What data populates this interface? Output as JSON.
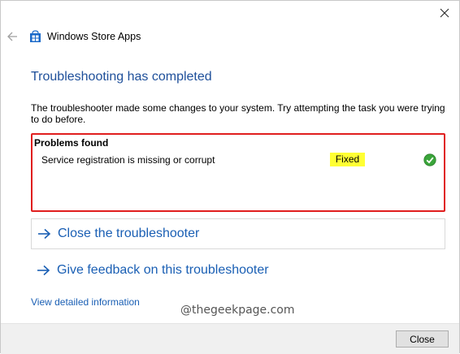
{
  "window": {
    "title": "Windows Store Apps"
  },
  "main": {
    "heading": "Troubleshooting has completed",
    "description": "The troubleshooter made some changes to your system. Try attempting the task you were trying to do before."
  },
  "problems": {
    "title": "Problems found",
    "items": [
      {
        "name": "Service registration is missing or corrupt",
        "status": "Fixed",
        "status_icon": "green-check-icon"
      }
    ]
  },
  "links": {
    "close_troubleshooter": "Close the troubleshooter",
    "give_feedback": "Give feedback on this troubleshooter",
    "view_details": "View detailed information"
  },
  "watermark": "@thegeekpage.com",
  "footer": {
    "close_label": "Close"
  },
  "colors": {
    "heading": "#1e4f9a",
    "link": "#1a5fb4",
    "highlight_border": "#e01e1e",
    "status_highlight": "#ffff33",
    "check_green": "#2e9b2e"
  }
}
